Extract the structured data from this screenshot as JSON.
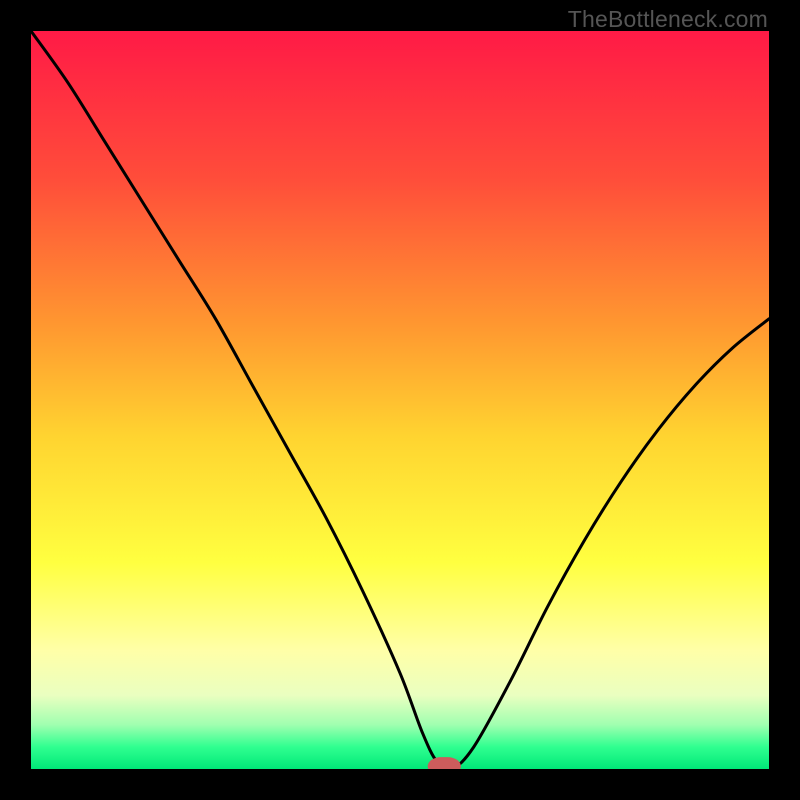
{
  "watermark": "TheBottleneck.com",
  "chart_data": {
    "type": "line",
    "title": "",
    "xlabel": "",
    "ylabel": "",
    "xlim": [
      0,
      100
    ],
    "ylim": [
      0,
      100
    ],
    "grid": false,
    "gradient_stops": [
      {
        "offset": 0,
        "color": "#ff1a46"
      },
      {
        "offset": 20,
        "color": "#ff4d3a"
      },
      {
        "offset": 40,
        "color": "#ff9830"
      },
      {
        "offset": 55,
        "color": "#ffd430"
      },
      {
        "offset": 72,
        "color": "#ffff40"
      },
      {
        "offset": 84,
        "color": "#ffffa8"
      },
      {
        "offset": 90,
        "color": "#eaffc0"
      },
      {
        "offset": 94,
        "color": "#a0ffb0"
      },
      {
        "offset": 97,
        "color": "#30ff90"
      },
      {
        "offset": 100,
        "color": "#00e878"
      }
    ],
    "series": [
      {
        "name": "bottleneck-curve",
        "x": [
          0,
          5,
          10,
          15,
          20,
          25,
          30,
          35,
          40,
          45,
          50,
          53,
          55,
          57,
          60,
          65,
          70,
          75,
          80,
          85,
          90,
          95,
          100
        ],
        "values": [
          100,
          93,
          85,
          77,
          69,
          61,
          52,
          43,
          34,
          24,
          13,
          5,
          1,
          0,
          3,
          12,
          22,
          31,
          39,
          46,
          52,
          57,
          61
        ]
      }
    ],
    "marker": {
      "name": "bottleneck-marker",
      "x": 56,
      "width": 4.5,
      "color": "#cd5c5c",
      "corner_radius": 1.8
    }
  }
}
